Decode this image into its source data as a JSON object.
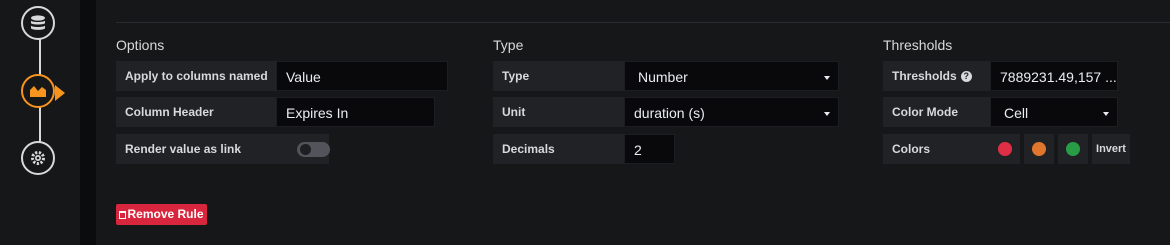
{
  "options": {
    "title": "Options",
    "apply_label": "Apply to columns named",
    "apply_value": "Value",
    "header_label": "Column Header",
    "header_value": "Expires In",
    "link_label": "Render value as link"
  },
  "type_section": {
    "title": "Type",
    "type_label": "Type",
    "type_value": "Number",
    "unit_label": "Unit",
    "unit_value": "duration (s)",
    "decimals_label": "Decimals",
    "decimals_value": "2"
  },
  "thresholds": {
    "title": "Thresholds",
    "thresholds_label": "Thresholds",
    "thresholds_value": "7889231.49,157 ...",
    "color_mode_label": "Color Mode",
    "color_mode_value": "Cell",
    "colors_label": "Colors",
    "colors": [
      "#e02f44",
      "#e0752d",
      "#299c46"
    ],
    "invert_label": "Invert"
  },
  "remove_rule_label": "Remove Rule",
  "accent": "#f7941e"
}
